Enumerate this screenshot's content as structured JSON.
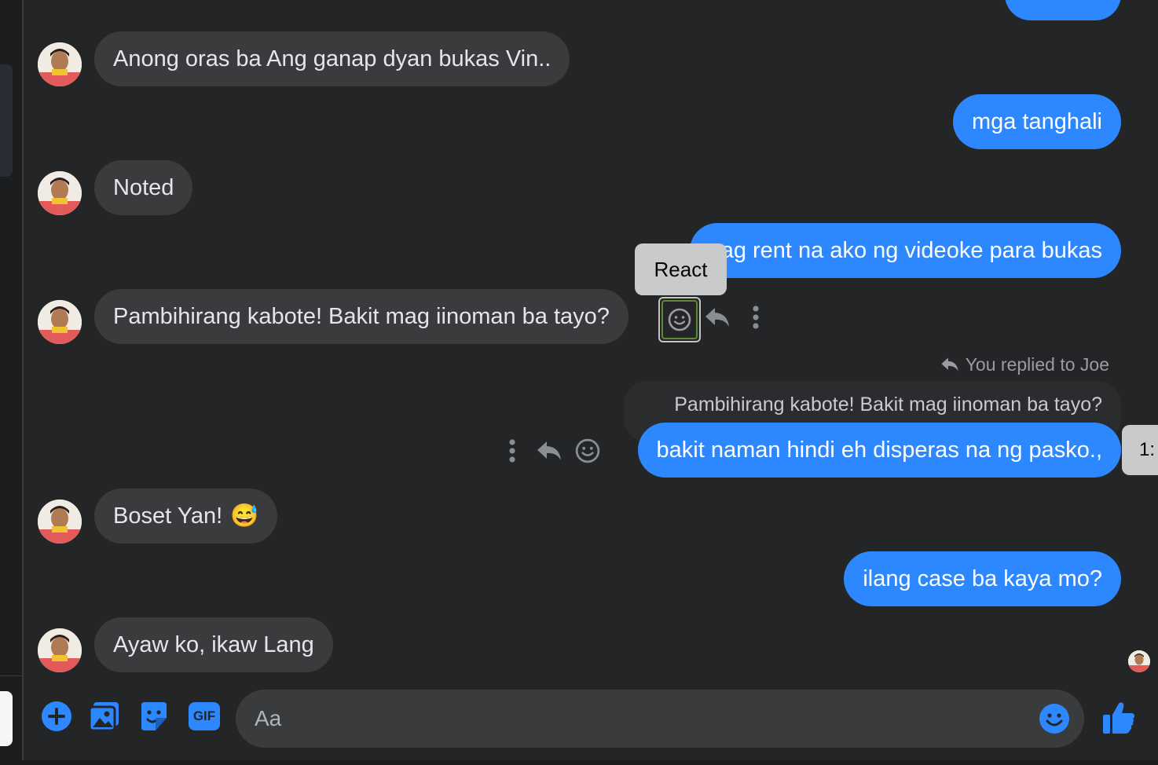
{
  "conversation": {
    "contact_name": "Joe",
    "messages": [
      {
        "side": "in",
        "text": "Anong oras ba Ang ganap dyan bukas Vin.."
      },
      {
        "side": "out",
        "text": "mga tanghali"
      },
      {
        "side": "in",
        "text": "Noted"
      },
      {
        "side": "out",
        "text": "nag rent na ako ng videoke para bukas"
      },
      {
        "side": "in",
        "text": "Pambihirang kabote! Bakit mag iinoman ba tayo?"
      },
      {
        "side": "out",
        "text": "bakit naman hindi eh disperas na ng pasko.,"
      },
      {
        "side": "in",
        "text": "Boset Yan!",
        "emoji": "😅"
      },
      {
        "side": "out",
        "text": "ilang case ba kaya mo?"
      },
      {
        "side": "in",
        "text": "Ayaw ko, ikaw Lang"
      }
    ],
    "reply": {
      "label": "You replied to Joe",
      "quoted_text": "Pambihirang kabote! Bakit mag iinoman ba tayo?"
    },
    "tooltip_react": "React",
    "time_partial": "1:"
  },
  "composer": {
    "placeholder": "Aa",
    "value": "",
    "icons": [
      "add-icon",
      "photo-icon",
      "sticker-icon",
      "gif-icon",
      "emoji-icon",
      "like-icon"
    ],
    "gif_label": "GIF"
  },
  "colors": {
    "background": "#242526",
    "incoming_bubble": "#3a3b3c",
    "outgoing_bubble": "#2d88ff",
    "accent": "#2d88ff"
  }
}
